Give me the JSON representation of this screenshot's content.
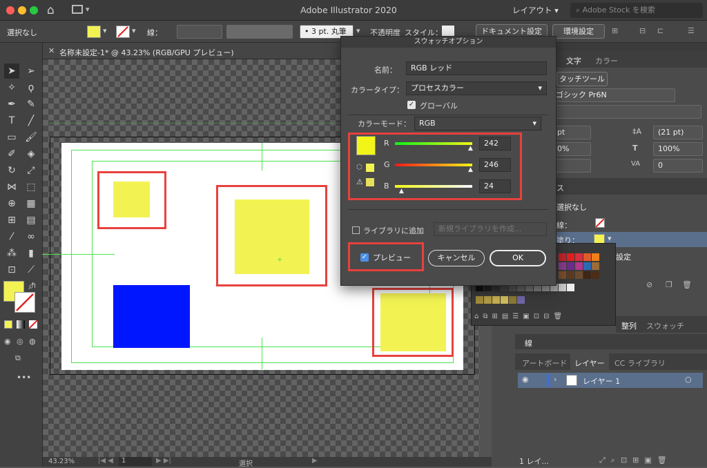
{
  "app": {
    "title": "Adobe Illustrator 2020",
    "workspace": "レイアウト",
    "search_placeholder": "Adobe Stock を検索"
  },
  "control": {
    "selection": "選択なし",
    "stroke_label": "線：",
    "stroke_profile": "3 pt. 丸筆",
    "opacity_label": "不透明度",
    "style_label": "スタイル：",
    "doc_setup": "ドキュメント設定",
    "prefs": "環境設定"
  },
  "doc": {
    "tab": "名称未設定-1* @ 43.23% (RGB/GPU プレビュー)"
  },
  "status": {
    "zoom": "43.23%",
    "page": "1",
    "mode": "選択"
  },
  "dialog": {
    "title": "スウォッチオプション",
    "name_label": "名前：",
    "name_value": "RGB レッド",
    "colortype_label": "カラータイプ：",
    "colortype_value": "プロセスカラー",
    "global_label": "グローバル",
    "global_checked": true,
    "colormode_label": "カラーモード：",
    "colormode_value": "RGB",
    "r_label": "R",
    "r_value": "242",
    "g_label": "G",
    "g_value": "246",
    "b_label": "B",
    "b_value": "24",
    "add_library_label": "ライブラリに追加",
    "library_placeholder": "新規ライブラリを作成...",
    "preview_label": "プレビュー",
    "preview_checked": true,
    "cancel": "キャンセル",
    "ok": "OK",
    "swatch_color": "#f2f618"
  },
  "panels": {
    "char_tab": "文字",
    "color_tab": "カラー",
    "touch_type": "タッチツール",
    "font_name": "ゴシック Pr6N",
    "font_size": "pt",
    "leading": "(21 pt)",
    "percent1": "0%",
    "percent2": "100%",
    "tracking": "0",
    "appearance_title": "ス",
    "app_none": "選択なし",
    "app_stroke": "線：",
    "app_fill": "塗り：",
    "app_settings": "設定",
    "align_tab": "整列",
    "swatches_tab": "スウォッチ",
    "stroke_title": "線",
    "layers_tabs": [
      "アートボード",
      "レイヤー",
      "CC ライブラリ"
    ],
    "layer_name": "レイヤー 1",
    "layer_count": "1 レイ..."
  },
  "colors": {
    "yellow": "#f2f353",
    "blue": "#0016ff",
    "red_box": "#e8413d",
    "guide": "#49e24d"
  }
}
